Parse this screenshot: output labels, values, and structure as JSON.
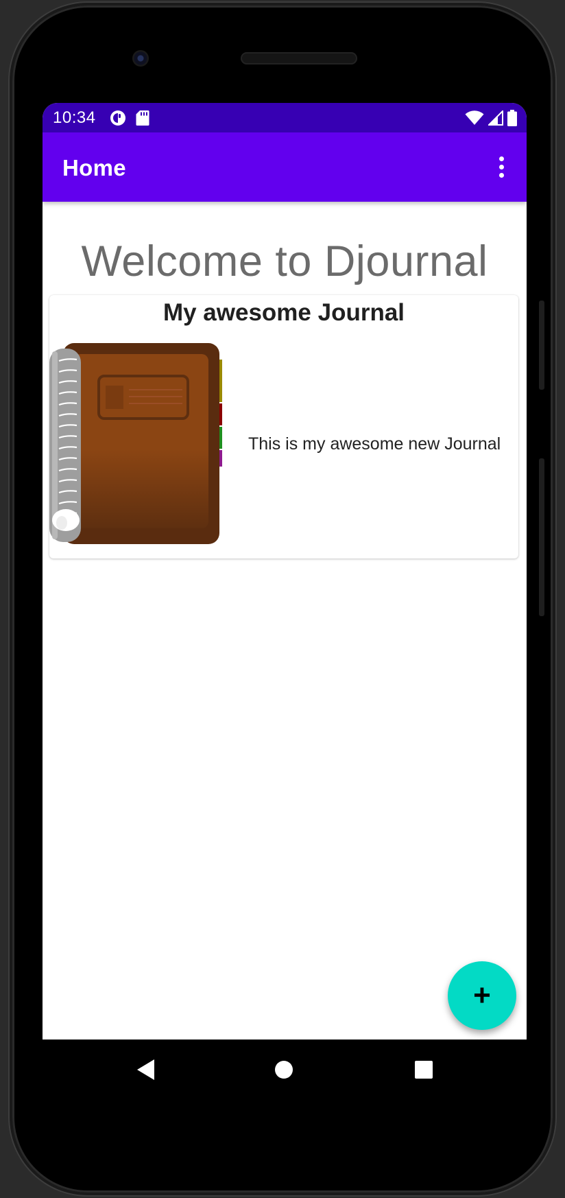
{
  "status_bar": {
    "time": "10:34"
  },
  "app_bar": {
    "title": "Home"
  },
  "main": {
    "welcome_text": "Welcome to Djournal",
    "journals": [
      {
        "title": "My awesome Journal",
        "description": "This is my awesome new Journal"
      }
    ]
  },
  "fab": {
    "icon": "+"
  },
  "icons": {
    "overflow": "more-vert-icon",
    "fab": "add-icon",
    "nav_back": "back-icon",
    "nav_home": "home-icon",
    "nav_recents": "recents-icon"
  },
  "colors": {
    "status_bar": "#3700b3",
    "app_bar": "#6200ee",
    "fab": "#03dac5",
    "welcome_text": "#6b6b6b"
  }
}
